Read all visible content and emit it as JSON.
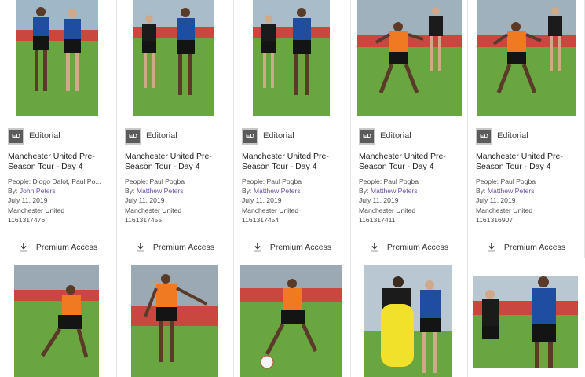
{
  "cards": [
    {
      "badge": "ED",
      "badge_label": "Editorial",
      "title": "Manchester United Pre-Season Tour - Day 4",
      "people": "People: Diogo Dalot, Paul Po...",
      "by_prefix": "By: ",
      "author": "John Peters",
      "date": "July 11, 2019",
      "org": "Manchester United",
      "id": "1161317476",
      "download": "Premium Access"
    },
    {
      "badge": "ED",
      "badge_label": "Editorial",
      "title": "Manchester United Pre-Season Tour - Day 4",
      "people": "People: Paul Pogba",
      "by_prefix": "By: ",
      "author": "Matthew Peters",
      "date": "July 11, 2019",
      "org": "Manchester United",
      "id": "1161317455",
      "download": "Premium Access"
    },
    {
      "badge": "ED",
      "badge_label": "Editorial",
      "title": "Manchester United Pre-Season Tour - Day 4",
      "people": "People: Paul Pogba",
      "by_prefix": "By: ",
      "author": "Matthew Peters",
      "date": "July 11, 2019",
      "org": "Manchester United",
      "id": "1161317454",
      "download": "Premium Access"
    },
    {
      "badge": "ED",
      "badge_label": "Editorial",
      "title": "Manchester United Pre-Season Tour - Day 4",
      "people": "People: Paul Pogba",
      "by_prefix": "By: ",
      "author": "Matthew Peters",
      "date": "July 11, 2019",
      "org": "Manchester United",
      "id": "1161317411",
      "download": "Premium Access"
    },
    {
      "badge": "ED",
      "badge_label": "Editorial",
      "title": "Manchester United Pre-Season Tour - Day 4",
      "people": "People: Paul Pogba",
      "by_prefix": "By: ",
      "author": "Matthew Peters",
      "date": "July 11, 2019",
      "org": "Manchester United",
      "id": "1161316907",
      "download": "Premium Access"
    }
  ],
  "colors": {
    "author_link": "#6a4fa8",
    "badge_bg": "#5b5b5b",
    "grass": "#5e9a3a",
    "kit_blue": "#1f4ea0",
    "kit_orange": "#f07a22",
    "kit_black": "#1b1b1b"
  }
}
